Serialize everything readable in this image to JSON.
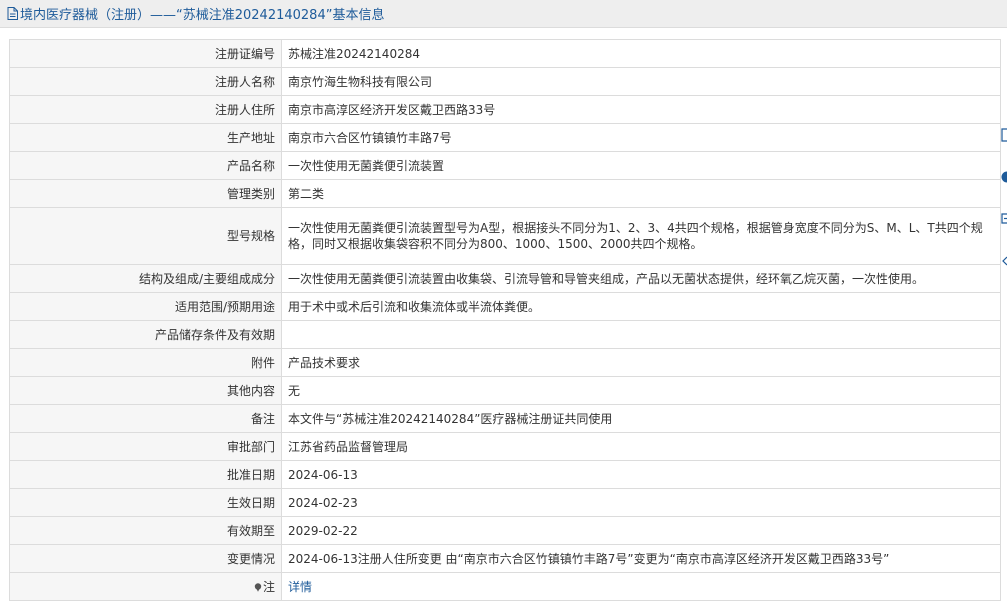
{
  "header": {
    "title": "境内医疗器械（注册）——“苏械注准20242140284”基本信息"
  },
  "rows": [
    {
      "label": "注册证编号",
      "value": "苏械注准20242140284"
    },
    {
      "label": "注册人名称",
      "value": "南京竹海生物科技有限公司"
    },
    {
      "label": "注册人住所",
      "value": "南京市高淳区经济开发区戴卫西路33号"
    },
    {
      "label": "生产地址",
      "value": "南京市六合区竹镇镇竹丰路7号"
    },
    {
      "label": "产品名称",
      "value": "一次性使用无菌粪便引流装置"
    },
    {
      "label": "管理类别",
      "value": "第二类"
    },
    {
      "label": "型号规格",
      "value": "一次性使用无菌粪便引流装置型号为A型，根据接头不同分为1、2、3、4共四个规格，根据管身宽度不同分为S、M、L、T共四个规格，同时又根据收集袋容积不同分为800、1000、1500、2000共四个规格。"
    },
    {
      "label": "结构及组成/主要组成成分",
      "value": "一次性使用无菌粪便引流装置由收集袋、引流导管和导管夹组成，产品以无菌状态提供，经环氧乙烷灭菌，一次性使用。"
    },
    {
      "label": "适用范围/预期用途",
      "value": "用于术中或术后引流和收集流体或半流体粪便。"
    },
    {
      "label": "产品储存条件及有效期",
      "value": ""
    },
    {
      "label": "附件",
      "value": "产品技术要求"
    },
    {
      "label": "其他内容",
      "value": "无"
    },
    {
      "label": "备注",
      "value": "本文件与“苏械注准20242140284”医疗器械注册证共同使用"
    },
    {
      "label": "审批部门",
      "value": "江苏省药品监督管理局"
    },
    {
      "label": "批准日期",
      "value": "2024-06-13"
    },
    {
      "label": "生效日期",
      "value": "2024-02-23"
    },
    {
      "label": "有效期至",
      "value": "2029-02-22"
    },
    {
      "label": "变更情况",
      "value": "2024-06-13注册人住所变更 由“南京市六合区竹镇镇竹丰路7号”变更为“南京市高淳区经济开发区戴卫西路33号”"
    }
  ],
  "note_row": {
    "label": "注",
    "link_text": "详情"
  },
  "colors": {
    "link": "#1e5b9a",
    "label_bg": "#f6f6f6",
    "border": "#dcdcdc",
    "header_bg": "#eeeeee"
  },
  "icons": {
    "title": "document-icon",
    "note": "pin-icon"
  }
}
